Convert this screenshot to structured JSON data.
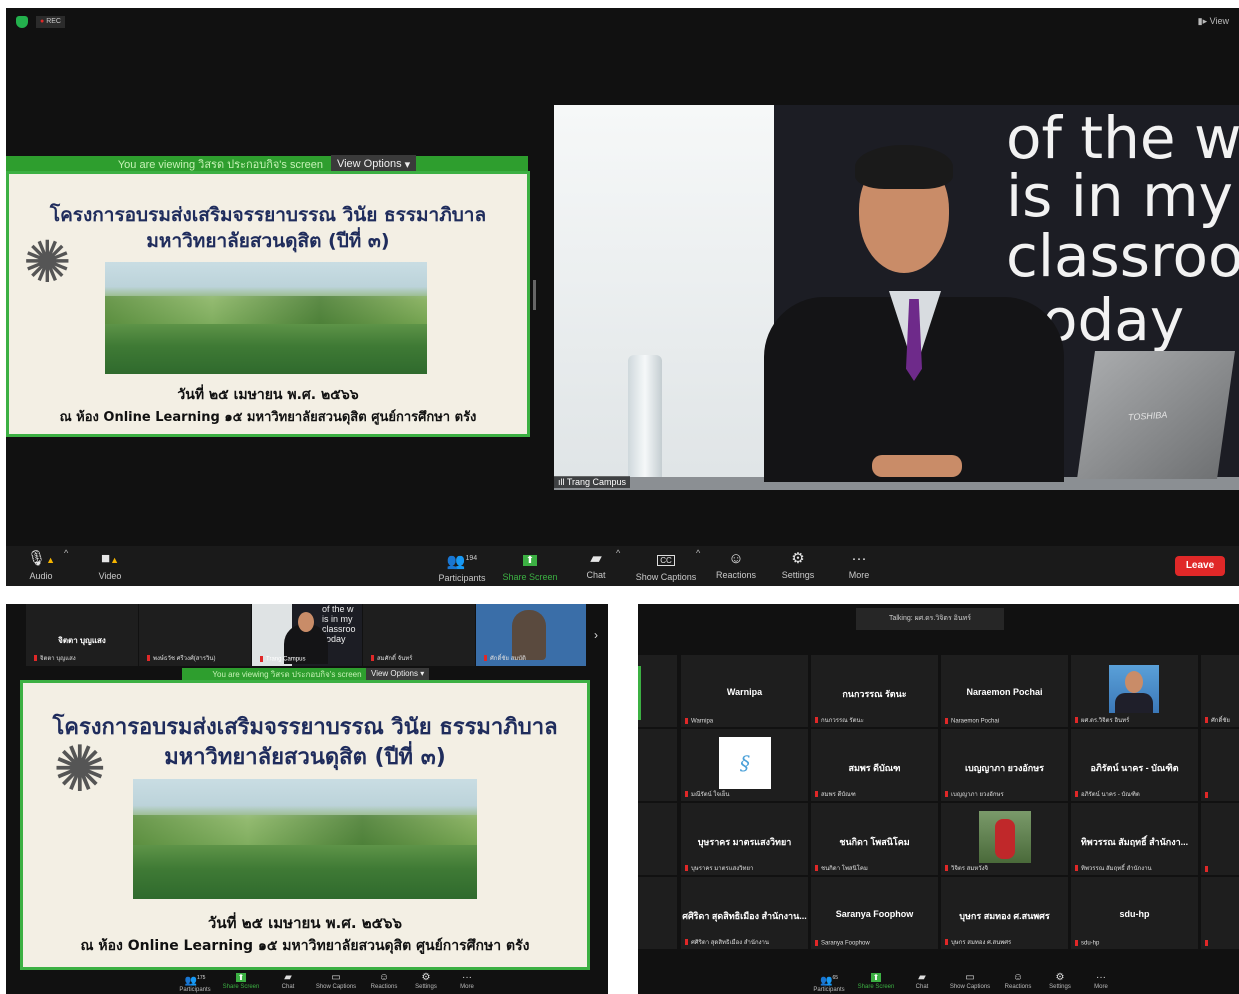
{
  "top": {
    "rec_label": "REC",
    "view_label": "View",
    "viewing_bar": "You are viewing วิสรด ประกอบกิจ's screen",
    "view_options": "View Options",
    "slide": {
      "title_line1": "โครงการอบรมส่งเสริมจรรยาบรรณ วินัย ธรรมาภิบาล",
      "title_line2": "มหาวิทยาลัยสวนดุสิต (ปีที่ ๓)",
      "date_line": "วันที่ ๒๕ เมษายน พ.ศ. ๒๕๖๖",
      "place_line": "ณ ห้อง Online Learning ๑๕ มหาวิทยาลัยสวนดุสิต ศูนย์การศึกษา ตรัง"
    },
    "speaker": {
      "wall_lines": [
        "of the w",
        "is in my",
        "classroo",
        "oday"
      ],
      "name_label": "Trang Campus",
      "laptop_brand": "TOSHIBA"
    },
    "toolbar": {
      "audio": "Audio",
      "video": "Video",
      "participants": "Participants",
      "participants_count": "194",
      "share_screen": "Share Screen",
      "chat": "Chat",
      "show_captions": "Show Captions",
      "reactions": "Reactions",
      "settings": "Settings",
      "more": "More",
      "leave": "Leave"
    },
    "colors": {
      "share_green": "#3cb043",
      "leave_red": "#e02828",
      "slide_title": "#1f2c5c"
    }
  },
  "bottom_left": {
    "strip": [
      {
        "name": "จิตตา บุญแสง",
        "sub": "จิตตา บุญแสง"
      },
      {
        "name": "",
        "sub": "พงษ์ธวัช ศรีวงศ์(สารวิน)"
      },
      {
        "name": "",
        "sub": "Trang Campus"
      },
      {
        "name": "",
        "sub": "สมศักดิ์ จันทร์"
      },
      {
        "name": "",
        "sub": "ศักดิ์ชัย สมบัติ"
      }
    ],
    "mini_wall_lines": [
      "of the w",
      "is in my",
      "classroo",
      "oday"
    ],
    "viewing_bar": "You are viewing วิสรด ประกอบกิจ's screen",
    "view_options": "View Options",
    "slide": {
      "title_line1": "โครงการอบรมส่งเสริมจรรยาบรรณ วินัย ธรรมาภิบาล",
      "title_line2": "มหาวิทยาลัยสวนดุสิต (ปีที่ ๓)",
      "date_line": "วันที่ ๒๕ เมษายน พ.ศ. ๒๕๖๖",
      "place_line": "ณ ห้อง Online Learning ๑๕ มหาวิทยาลัยสวนดุสิต ศูนย์การศึกษา ตรัง"
    },
    "toolbar": [
      "Participants",
      "Share Screen",
      "Chat",
      "Show Captions",
      "Reactions",
      "Settings",
      "More"
    ],
    "participants_count": "175"
  },
  "bottom_right": {
    "talking": "Talking: ผศ.ดร.วิจิตร อินทร์",
    "tiles": [
      {
        "name": "",
        "sub": ""
      },
      {
        "name": "Warnipa",
        "sub": "Warnipa"
      },
      {
        "name": "กนกวรรณ รัตนะ",
        "sub": "กนกวรรณ รัตนะ"
      },
      {
        "name": "Naraemon Pochai",
        "sub": "Naraemon Pochai"
      },
      {
        "name": "",
        "sub": "ผศ.ดร.วิจิตร อินทร์"
      },
      {
        "name": "ศักดิ์ชัย",
        "sub": "ศักดิ์ชัย"
      },
      {
        "name": "ลงศ์",
        "sub": ""
      },
      {
        "name": "",
        "sub": "มณีรัตน์ ใจเย็น"
      },
      {
        "name": "สมพร ดีบัณฑ",
        "sub": "สมพร ดีบัณฑ"
      },
      {
        "name": "เบญญาภา ยวงอักษร",
        "sub": "เบญญาภา ยวงอักษร"
      },
      {
        "name": "อภิรัตน์ นาคร - บัณฑิต",
        "sub": "อภิรัตน์ นาคร - บัณฑิต"
      },
      {
        "name": "",
        "sub": ""
      },
      {
        "name": "สำนัก...",
        "sub": ""
      },
      {
        "name": "บุษราคร มาตรแสงวิทยา",
        "sub": "บุษราคร มาตรแสงวิทยา"
      },
      {
        "name": "ชนกิดา โพสนิโคม",
        "sub": "ชนกิดา โพสนิโคม"
      },
      {
        "name": "",
        "sub": "วิจิตร สมหวังจิ"
      },
      {
        "name": "ทิพวรรณ สัมฤทธิ์ สำนักงา...",
        "sub": "ทิพวรรณ สัมฤทธิ์ สำนักงาน"
      },
      {
        "name": "ส",
        "sub": ""
      },
      {
        "name": "อจาก...",
        "sub": ""
      },
      {
        "name": "ศศิริดา สุดสิทธิเมือง สำนักงาน...",
        "sub": "ศศิริดา สุดสิทธิเมือง สำนักงาน"
      },
      {
        "name": "Saranya Foophow",
        "sub": "Saranya Foophow"
      },
      {
        "name": "บุษกร สมทอง ศ.สนพศร",
        "sub": "บุษกร สมทอง ศ.สนพศร"
      },
      {
        "name": "sdu-hp",
        "sub": "sdu-hp"
      },
      {
        "name": "จันท",
        "sub": ""
      }
    ],
    "toolbar": [
      "Participants",
      "Share Screen",
      "Chat",
      "Show Captions",
      "Reactions",
      "Settings",
      "More"
    ],
    "participants_count": "65"
  }
}
